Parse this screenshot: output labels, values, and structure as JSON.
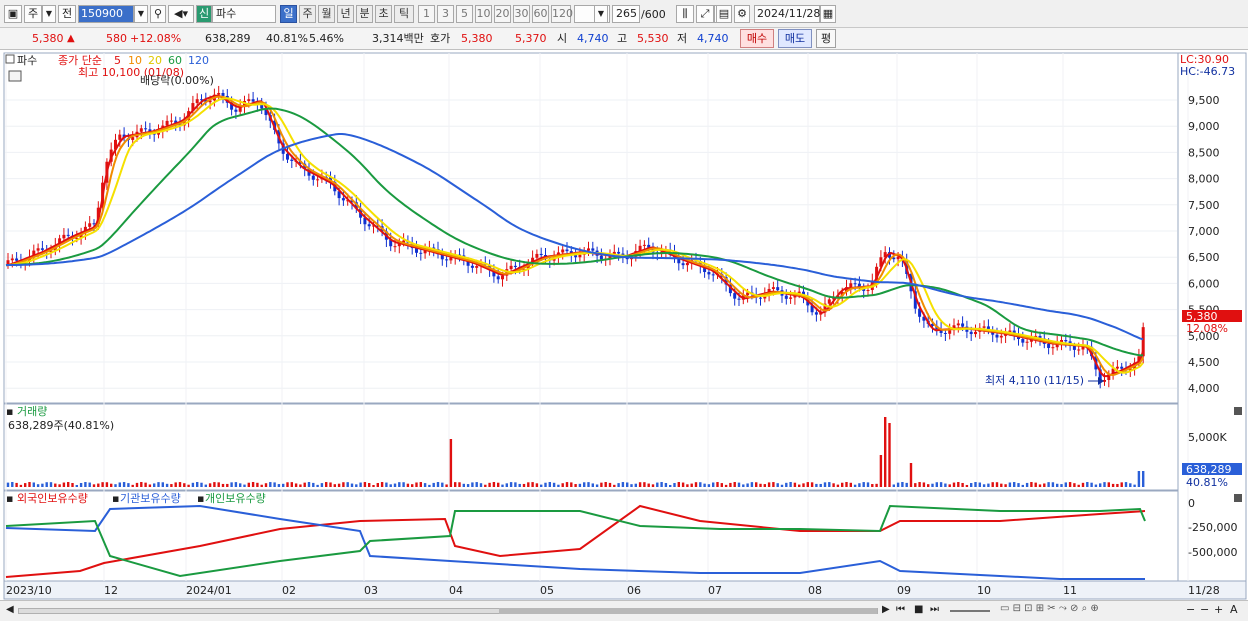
{
  "toolbar": {
    "period_label": "주",
    "prev_label": "전",
    "stock_code": "150900",
    "stock_kind": "신",
    "stock_name": "파수",
    "period_tabs": [
      "일",
      "주",
      "월",
      "년",
      "분",
      "초",
      "틱"
    ],
    "active_tab": "일",
    "interval_tabs": [
      "1",
      "3",
      "5",
      "10",
      "20",
      "30",
      "60",
      "120"
    ],
    "count": "265",
    "count_max": "/600",
    "date": "2024/11/28"
  },
  "quote": {
    "price": "5,380",
    "change": "580",
    "change_pct": "+12.08%",
    "volume": "638,289",
    "volume_ratio": "40.81%",
    "turnover_pct": "5.46%",
    "amount": "3,314백만",
    "hoga_label": "호가",
    "ask": "5,380",
    "bid": "5,370",
    "open_label": "시",
    "open": "4,740",
    "high_label": "고",
    "high": "5,530",
    "low_label": "저",
    "low": "4,740",
    "buy_label": "매수",
    "sell_label": "매도",
    "eval_label": "평"
  },
  "price_panel": {
    "stock_tag": "파수",
    "ma_title": "종가 단순",
    "ma_periods": [
      "5",
      "10",
      "20",
      "60",
      "120"
    ],
    "ma_colors": [
      "#e01010",
      "#f08c00",
      "#f5e000",
      "#1a9a40",
      "#2a5fd8"
    ],
    "high_note": "최고 10,100 (01/08)",
    "dividend_note": "배당락(0.00%)",
    "low_note": "최저 4,110 (11/15)",
    "lc": "LC:30.90",
    "hc": "HC:-46.73",
    "last_price": "5,380",
    "last_change": "12.08%",
    "y_ticks": [
      "9,500",
      "9,000",
      "8,500",
      "8,000",
      "7,500",
      "7,000",
      "6,500",
      "6,000",
      "5,500",
      "5,000",
      "4,500",
      "4,000"
    ]
  },
  "volume_panel": {
    "title": "거래량",
    "value": "638,289주(40.81%)",
    "y_tick": "5,000K",
    "last": "638,289",
    "last_pct": "40.81%"
  },
  "holdings_panel": {
    "series": [
      "외국인보유수량",
      "기관보유수량",
      "개인보유수량"
    ],
    "colors": [
      "#e01010",
      "#2a5fd8",
      "#1a9a40"
    ],
    "y_ticks": [
      "0",
      "-250,000",
      "-500,000"
    ]
  },
  "x_axis": [
    "2023/10",
    "12",
    "2024/01",
    "02",
    "03",
    "04",
    "05",
    "06",
    "07",
    "08",
    "09",
    "10",
    "11",
    "11/28"
  ]
}
